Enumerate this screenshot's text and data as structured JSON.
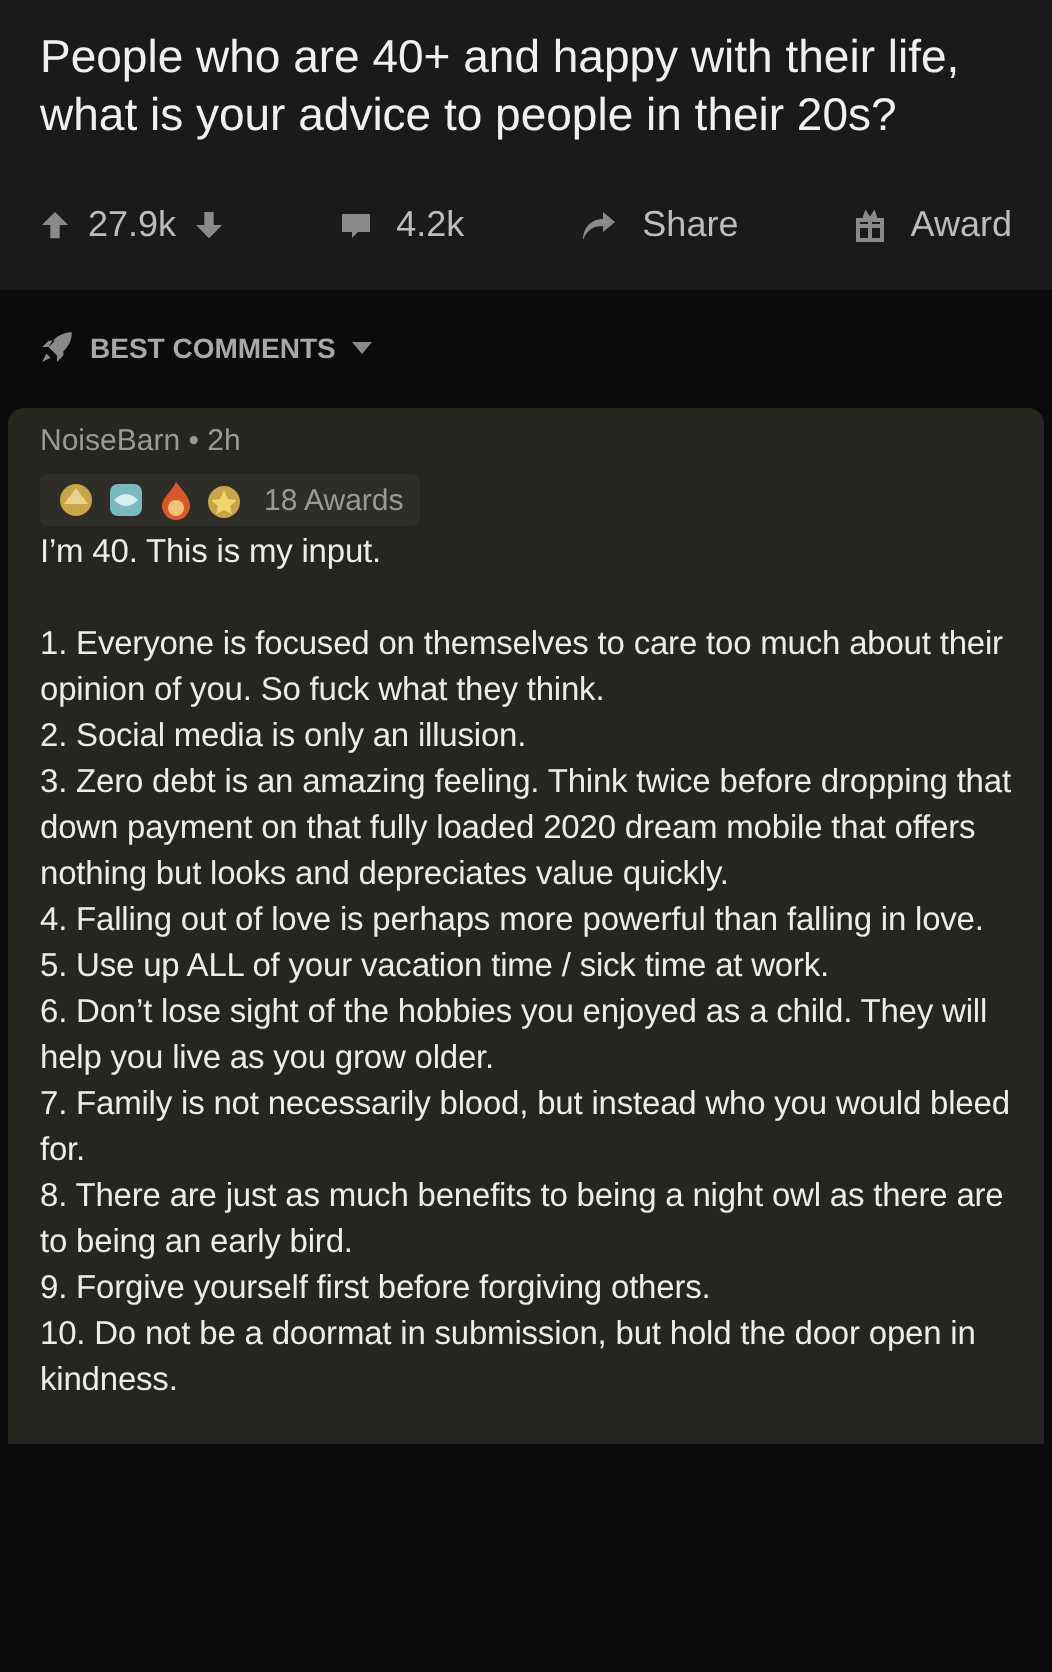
{
  "post": {
    "title": "People who are 40+ and happy with their life, what is your advice to people in their 20s?"
  },
  "actions": {
    "upvotes": "27.9k",
    "comments": "4.2k",
    "share": "Share",
    "award": "Award"
  },
  "sort": {
    "label": "BEST COMMENTS"
  },
  "comment": {
    "meta": "NoiseBarn • 2h",
    "awards": "18 Awards",
    "intro": "I’m 40. This is my input.",
    "points": [
      "1. Everyone is focused on themselves to care too much about their opinion of you. So fuck what they think.",
      "2. Social media is only an illusion.",
      "3. Zero debt is an amazing feeling. Think twice before dropping that down payment on that fully loaded 2020 dream mobile that offers nothing but looks and depreciates value quickly.",
      "4. Falling out of love is perhaps more powerful than falling in love.",
      "5. Use up ALL of your vacation time / sick time at work.",
      "6. Don’t lose sight of the hobbies you enjoyed as a child. They will help you live as you grow older.",
      "7. Family is not necessarily blood, but instead who you would bleed for.",
      "8. There are just as much benefits to being a night owl as there are to being an early bird.",
      "9. Forgive yourself first before forgiving others.",
      "10. Do not be a doormat in submission, but hold the door open in kindness."
    ]
  }
}
